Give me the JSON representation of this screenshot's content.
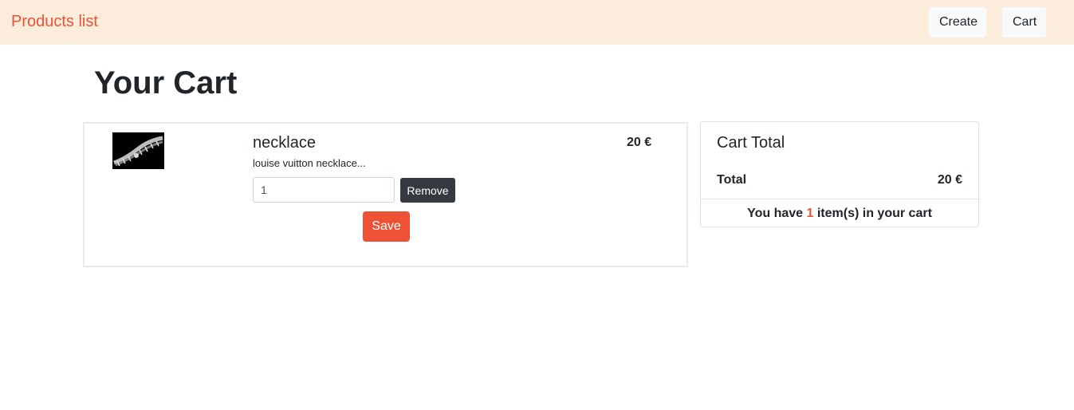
{
  "navbar": {
    "brand": "Products list",
    "create_label": "Create",
    "cart_label": "Cart"
  },
  "page": {
    "title": "Your Cart"
  },
  "cart_items": [
    {
      "name": "necklace",
      "description": "louise vuitton necklace...",
      "price": "20 €",
      "quantity": "1",
      "remove_label": "Remove",
      "image_icon": "necklace-photo"
    }
  ],
  "actions": {
    "save_label": "Save"
  },
  "summary": {
    "title": "Cart Total",
    "total_label": "Total",
    "total_value": "20 €",
    "footer_prefix": "You have",
    "item_count": "1",
    "footer_suffix": "item(s) in your cart"
  },
  "colors": {
    "accent": "#ee5236",
    "navbar_bg": "#fcecdb",
    "dark_button": "#343a40"
  }
}
